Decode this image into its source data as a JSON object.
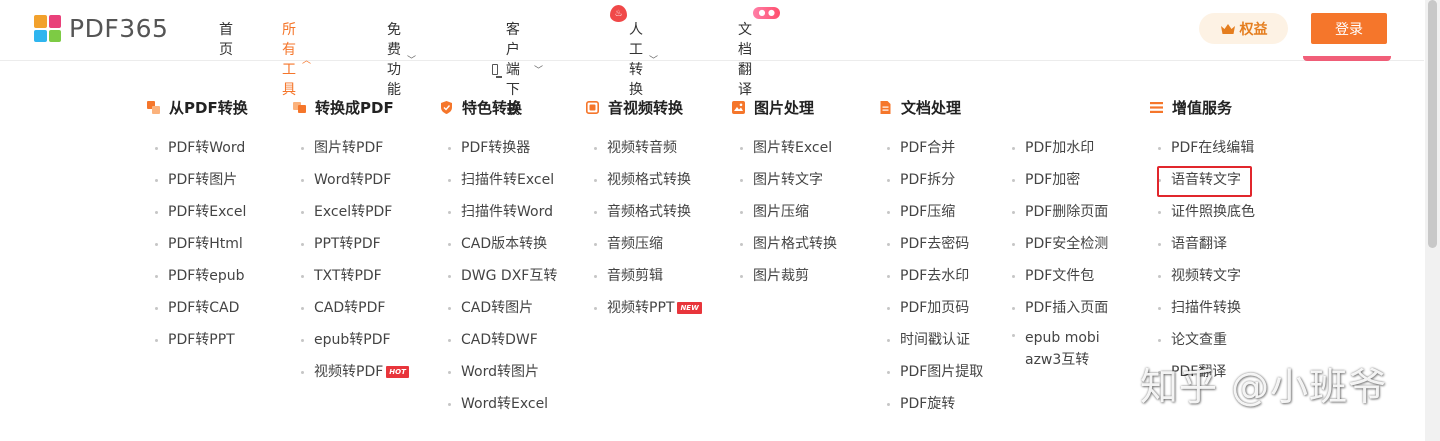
{
  "header": {
    "logo_text": "PDF365",
    "nav": [
      {
        "label": "首页"
      },
      {
        "label": "所有工具"
      },
      {
        "label": "免费功能"
      },
      {
        "label": "客户端下载"
      },
      {
        "label": "人工转换"
      },
      {
        "label": "文档翻译"
      }
    ],
    "rights_label": "权益",
    "login_label": "登录"
  },
  "colors": {
    "accent": "#f5762b",
    "highlight": "#e1262c"
  },
  "columns": [
    {
      "title": "从PDF转换",
      "icon": "pdf-convert-icon",
      "items": [
        "PDF转Word",
        "PDF转图片",
        "PDF转Excel",
        "PDF转Html",
        "PDF转epub",
        "PDF转CAD",
        "PDF转PPT"
      ]
    },
    {
      "title": "转换成PDF",
      "icon": "to-pdf-icon",
      "items": [
        "图片转PDF",
        "Word转PDF",
        "Excel转PDF",
        "PPT转PDF",
        "TXT转PDF",
        "CAD转PDF",
        "epub转PDF",
        "视频转PDF"
      ],
      "badge": {
        "index": 7,
        "text": "HOT"
      }
    },
    {
      "title": "特色转换",
      "icon": "shield-icon",
      "items": [
        "PDF转换器",
        "扫描件转Excel",
        "扫描件转Word",
        "CAD版本转换",
        "DWG DXF互转",
        "CAD转图片",
        "CAD转DWF",
        "Word转图片",
        "Word转Excel"
      ]
    },
    {
      "title": "音视频转换",
      "icon": "video-icon",
      "items": [
        "视频转音频",
        "视频格式转换",
        "音频格式转换",
        "音频压缩",
        "音频剪辑",
        "视频转PPT"
      ],
      "badge": {
        "index": 5,
        "text": "NEW"
      }
    },
    {
      "title": "图片处理",
      "icon": "image-icon",
      "items": [
        "图片转Excel",
        "图片转文字",
        "图片压缩",
        "图片格式转换",
        "图片裁剪"
      ]
    },
    {
      "title": "文档处理",
      "icon": "document-icon",
      "items": [
        "PDF合并",
        "PDF拆分",
        "PDF压缩",
        "PDF去密码",
        "PDF去水印",
        "PDF加页码",
        "时间戳认证",
        "PDF图片提取",
        "PDF旋转"
      ]
    },
    {
      "title": "",
      "items": [
        "PDF加水印",
        "PDF加密",
        "PDF删除页面",
        "PDF安全检测",
        "PDF文件包",
        "PDF插入页面",
        "epub mobi azw3互转"
      ]
    },
    {
      "title": "增值服务",
      "icon": "list-icon",
      "items": [
        "PDF在线编辑",
        "语音转文字",
        "证件照换底色",
        "语音翻译",
        "视频转文字",
        "扫描件转换",
        "论文查重",
        "PDF翻译"
      ]
    }
  ],
  "watermark": "知乎 @小班爷"
}
